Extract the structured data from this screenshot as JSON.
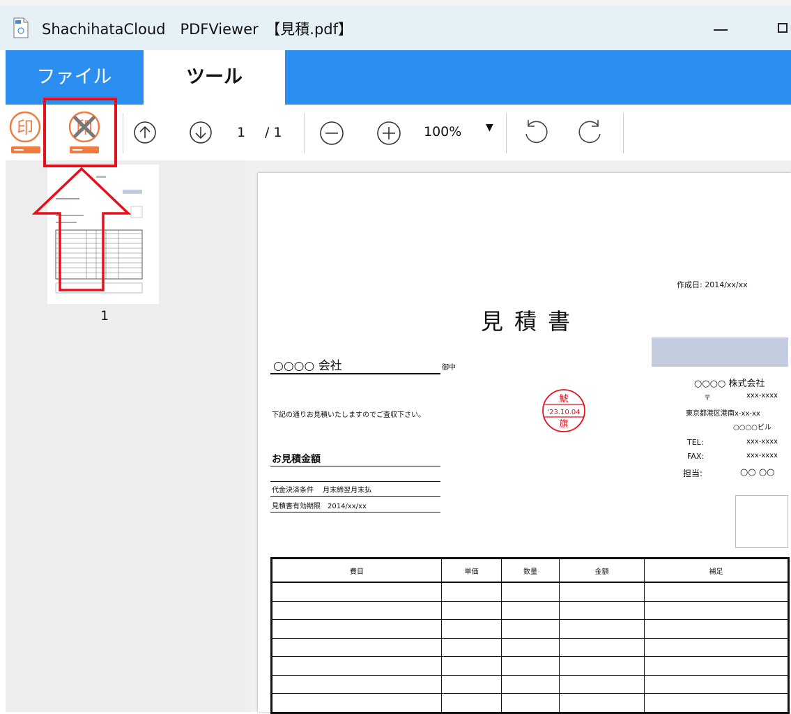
{
  "window": {
    "title": "ShachihataCloud　PDFViewer　【見積.pdf】"
  },
  "tabs": [
    {
      "label": "ファイル",
      "active": false
    },
    {
      "label": "ツール",
      "active": true
    }
  ],
  "toolbar": {
    "stamp_icon_char": "印",
    "page_current": "1",
    "page_total": "/ 1",
    "zoom": "100%",
    "icons": [
      "stamp-icon",
      "stamp-delete-icon",
      "arrow-up-icon",
      "arrow-down-icon",
      "zoom-out-icon",
      "zoom-in-icon",
      "rotate-left-icon",
      "rotate-right-icon"
    ]
  },
  "sidebar": {
    "thumbnail_label": "1"
  },
  "document": {
    "date": "作成日: 2014/xx/xx",
    "title": "見積書",
    "recipient": "○○○○ 会社",
    "recipient_suffix": "御中",
    "intro": "下記の通りお見積いたしますのでご査収下さい。",
    "amount_label": "お見積金額",
    "payment_terms": "代金決済条件　 月末締翌月末払",
    "validity": "見積書有効期限　2014/xx/xx",
    "company_name": "○○○○ 株式会社",
    "postal_mark": "〒",
    "postal_code": "xxx-xxxx",
    "address": "東京都港区港南x-xx-xx",
    "building": "○○○○ビル",
    "tel_label": "TEL:",
    "tel_value": "xxx-xxxx",
    "fax_label": "FAX:",
    "fax_value": "xxx-xxxx",
    "person_label": "担当:",
    "person_value": "○○ ○○",
    "seal": {
      "top": "鯱",
      "date": "'23.10.04",
      "bottom": "旗",
      "color": "#e5101a"
    },
    "table_headers": [
      "費目",
      "単価",
      "数量",
      "金額",
      "補足"
    ]
  },
  "colors": {
    "ribbon": "#2b8ff2",
    "titlebar": "#e6f1f7",
    "stamp_orange": "#f07a40",
    "highlight_red": "#e5101a"
  }
}
